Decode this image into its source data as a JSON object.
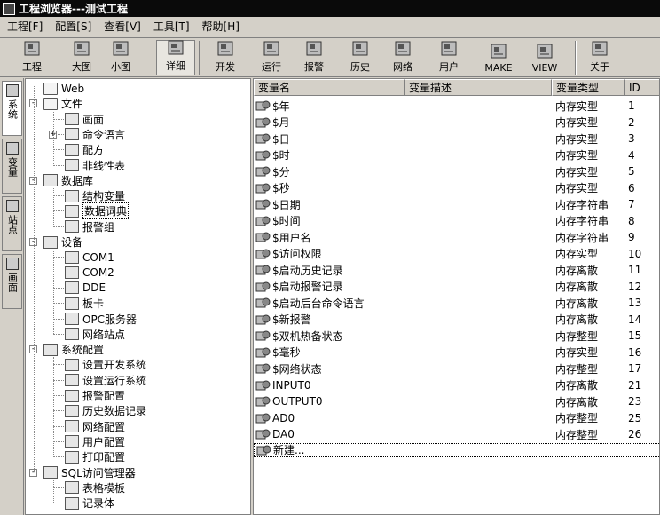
{
  "window": {
    "title": "工程浏览器---测试工程"
  },
  "menu": [
    "工程[F]",
    "配置[S]",
    "查看[V]",
    "工具[T]",
    "帮助[H]"
  ],
  "toolbar": [
    {
      "label": "工程",
      "icon": "project-icon"
    },
    {
      "label": "大图",
      "icon": "large-icons-icon"
    },
    {
      "label": "小图",
      "icon": "small-icons-icon"
    },
    {
      "label": "详细",
      "icon": "details-view-icon",
      "active": true
    },
    {
      "label": "开发",
      "icon": "develop-icon"
    },
    {
      "label": "运行",
      "icon": "run-icon"
    },
    {
      "label": "报警",
      "icon": "alarm-icon"
    },
    {
      "label": "历史",
      "icon": "history-icon"
    },
    {
      "label": "网络",
      "icon": "network-icon"
    },
    {
      "label": "用户",
      "icon": "user-icon"
    },
    {
      "label": "MAKE",
      "icon": "make-icon"
    },
    {
      "label": "VIEW",
      "icon": "view-icon"
    },
    {
      "label": "关于",
      "icon": "about-icon"
    }
  ],
  "side_tabs": [
    {
      "label": "系统",
      "icon": "system-icon"
    },
    {
      "label": "变量",
      "icon": "variable-icon"
    },
    {
      "label": "站点",
      "icon": "station-icon"
    },
    {
      "label": "画面",
      "icon": "screen-icon"
    }
  ],
  "tree": [
    {
      "label": "Web",
      "depth": 1,
      "icon": "folder-icon"
    },
    {
      "label": "文件",
      "depth": 0,
      "icon": "folder-icon",
      "expander": "-"
    },
    {
      "label": "画面",
      "depth": 2,
      "icon": "screen-icon"
    },
    {
      "label": "命令语言",
      "depth": 2,
      "icon": "command-icon",
      "expander": "+"
    },
    {
      "label": "配方",
      "depth": 2,
      "icon": "recipe-icon"
    },
    {
      "label": "非线性表",
      "depth": 2,
      "icon": "table-icon"
    },
    {
      "label": "数据库",
      "depth": 0,
      "icon": "database-icon",
      "expander": "-"
    },
    {
      "label": "结构变量",
      "depth": 2,
      "icon": "struct-icon"
    },
    {
      "label": "数据词典",
      "depth": 2,
      "icon": "dictionary-icon",
      "selected": true
    },
    {
      "label": "报警组",
      "depth": 2,
      "icon": "alarm-group-icon"
    },
    {
      "label": "设备",
      "depth": 0,
      "icon": "device-icon",
      "expander": "-"
    },
    {
      "label": "COM1",
      "depth": 2,
      "icon": "serial-port-icon"
    },
    {
      "label": "COM2",
      "depth": 2,
      "icon": "serial-port-icon"
    },
    {
      "label": "DDE",
      "depth": 2,
      "icon": "dde-icon"
    },
    {
      "label": "板卡",
      "depth": 2,
      "icon": "board-icon"
    },
    {
      "label": "OPC服务器",
      "depth": 2,
      "icon": "opc-icon"
    },
    {
      "label": "网络站点",
      "depth": 2,
      "icon": "network-station-icon"
    },
    {
      "label": "系统配置",
      "depth": 0,
      "icon": "tools-icon",
      "expander": "-"
    },
    {
      "label": "设置开发系统",
      "depth": 2,
      "icon": "dev-settings-icon"
    },
    {
      "label": "设置运行系统",
      "depth": 2,
      "icon": "run-settings-icon"
    },
    {
      "label": "报警配置",
      "depth": 2,
      "icon": "alarm-config-icon"
    },
    {
      "label": "历史数据记录",
      "depth": 2,
      "icon": "history-record-icon"
    },
    {
      "label": "网络配置",
      "depth": 2,
      "icon": "network-config-icon"
    },
    {
      "label": "用户配置",
      "depth": 2,
      "icon": "user-config-icon"
    },
    {
      "label": "打印配置",
      "depth": 2,
      "icon": "print-config-icon"
    },
    {
      "label": "SQL访问管理器",
      "depth": 0,
      "icon": "sql-icon",
      "expander": "-"
    },
    {
      "label": "表格模板",
      "depth": 2,
      "icon": "table-template-icon"
    },
    {
      "label": "记录体",
      "depth": 2,
      "icon": "record-icon"
    }
  ],
  "list": {
    "columns": [
      "变量名",
      "变量描述",
      "变量类型",
      "ID"
    ],
    "rows": [
      {
        "name": "$年",
        "desc": "",
        "type": "内存实型",
        "id": "1"
      },
      {
        "name": "$月",
        "desc": "",
        "type": "内存实型",
        "id": "2"
      },
      {
        "name": "$日",
        "desc": "",
        "type": "内存实型",
        "id": "3"
      },
      {
        "name": "$时",
        "desc": "",
        "type": "内存实型",
        "id": "4"
      },
      {
        "name": "$分",
        "desc": "",
        "type": "内存实型",
        "id": "5"
      },
      {
        "name": "$秒",
        "desc": "",
        "type": "内存实型",
        "id": "6"
      },
      {
        "name": "$日期",
        "desc": "",
        "type": "内存字符串",
        "id": "7"
      },
      {
        "name": "$时间",
        "desc": "",
        "type": "内存字符串",
        "id": "8"
      },
      {
        "name": "$用户名",
        "desc": "",
        "type": "内存字符串",
        "id": "9"
      },
      {
        "name": "$访问权限",
        "desc": "",
        "type": "内存实型",
        "id": "10"
      },
      {
        "name": "$启动历史记录",
        "desc": "",
        "type": "内存离散",
        "id": "11"
      },
      {
        "name": "$启动报警记录",
        "desc": "",
        "type": "内存离散",
        "id": "12"
      },
      {
        "name": "$启动后台命令语言",
        "desc": "",
        "type": "内存离散",
        "id": "13"
      },
      {
        "name": "$新报警",
        "desc": "",
        "type": "内存离散",
        "id": "14"
      },
      {
        "name": "$双机热备状态",
        "desc": "",
        "type": "内存整型",
        "id": "15"
      },
      {
        "name": "$毫秒",
        "desc": "",
        "type": "内存实型",
        "id": "16"
      },
      {
        "name": "$网络状态",
        "desc": "",
        "type": "内存整型",
        "id": "17"
      },
      {
        "name": "INPUT0",
        "desc": "",
        "type": "内存离散",
        "id": "21"
      },
      {
        "name": "OUTPUT0",
        "desc": "",
        "type": "内存离散",
        "id": "23"
      },
      {
        "name": "AD0",
        "desc": "",
        "type": "内存整型",
        "id": "25"
      },
      {
        "name": "DA0",
        "desc": "",
        "type": "内存整型",
        "id": "26"
      }
    ],
    "new_item": "新建..."
  }
}
